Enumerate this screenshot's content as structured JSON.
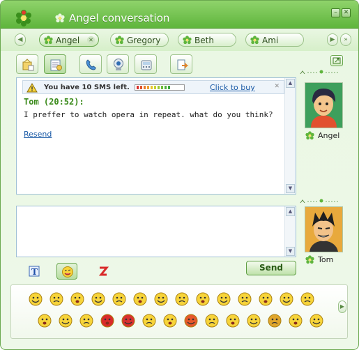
{
  "window": {
    "title": "Angel conversation"
  },
  "tabs": [
    {
      "label": "Angel",
      "active": true,
      "closable": true
    },
    {
      "label": "Gregory",
      "active": false
    },
    {
      "label": "Beth",
      "active": false
    },
    {
      "label": "Ami",
      "active": false
    }
  ],
  "toolbar": {
    "buttons": [
      "contact-info-icon",
      "history-icon",
      "phone-icon",
      "webcam-icon",
      "sms-icon",
      "send-file-icon"
    ]
  },
  "sms_notice": {
    "text": "You have 10 SMS left.",
    "link": "Click to buy",
    "meter_colors": [
      "#d9302b",
      "#e0522a",
      "#e87a2b",
      "#eda02c",
      "#e8c52d",
      "#c9d12f",
      "#9bc836",
      "#6fbd3a",
      "#4fb13d",
      "#3ca63e"
    ]
  },
  "message": {
    "sender": "Tom (20:52):",
    "text": "I preffer to watch opera in repeat. what do you think?",
    "resend": "Resend"
  },
  "contacts": {
    "remote": {
      "name": "Angel"
    },
    "local": {
      "name": "Tom"
    }
  },
  "format_tools": [
    "text-format-icon",
    "emoticon-icon",
    "nudge-icon"
  ],
  "send_label": "Send",
  "emoticons": [
    "smile",
    "sad",
    "grin",
    "worried",
    "surprised",
    "cool",
    "wink",
    "thumbs-up-face",
    "kiss",
    "angry",
    "confused",
    "tongue",
    "laugh",
    "hand-raise",
    "blush",
    "kissing",
    "shy",
    "devil",
    "rose",
    "hug",
    "sick",
    "star-burst",
    "crazy",
    "thumbs-up",
    "cry",
    "beer",
    "sleepy",
    "love"
  ],
  "colors": {
    "accent": "#5fb53c",
    "link": "#1a5aa6",
    "sender": "#3a8a1a"
  }
}
